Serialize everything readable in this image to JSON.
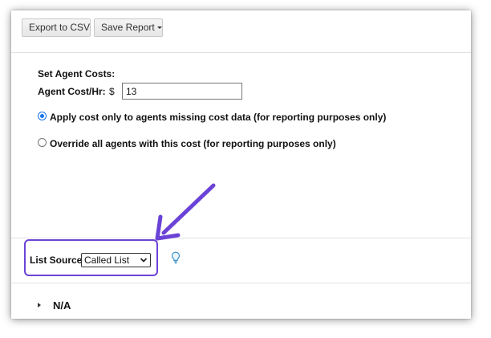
{
  "toolbar": {
    "export_label": "Export to CSV",
    "save_label": "Save Report"
  },
  "agent_costs": {
    "section_title": "Set Agent Costs:",
    "cost_label": "Agent Cost/Hr:",
    "currency_symbol": "$",
    "cost_value": "13"
  },
  "cost_options": [
    {
      "label": "Apply cost only to agents missing cost data (for reporting purposes only)",
      "checked": true
    },
    {
      "label": "Override all agents with this cost (for reporting purposes only)",
      "checked": false
    }
  ],
  "list_source": {
    "label": "List Source:",
    "selected": "Called List",
    "help_icon": "lightbulb-icon"
  },
  "group": {
    "label": "N/A",
    "expander_icon": "caret-right-icon"
  },
  "annotation": {
    "highlight_color": "#6b43d6",
    "arrow_icon": "arrow-icon"
  },
  "colors": {
    "radio_accent": "#1a73e8",
    "help_icon": "#3a8fc7"
  }
}
